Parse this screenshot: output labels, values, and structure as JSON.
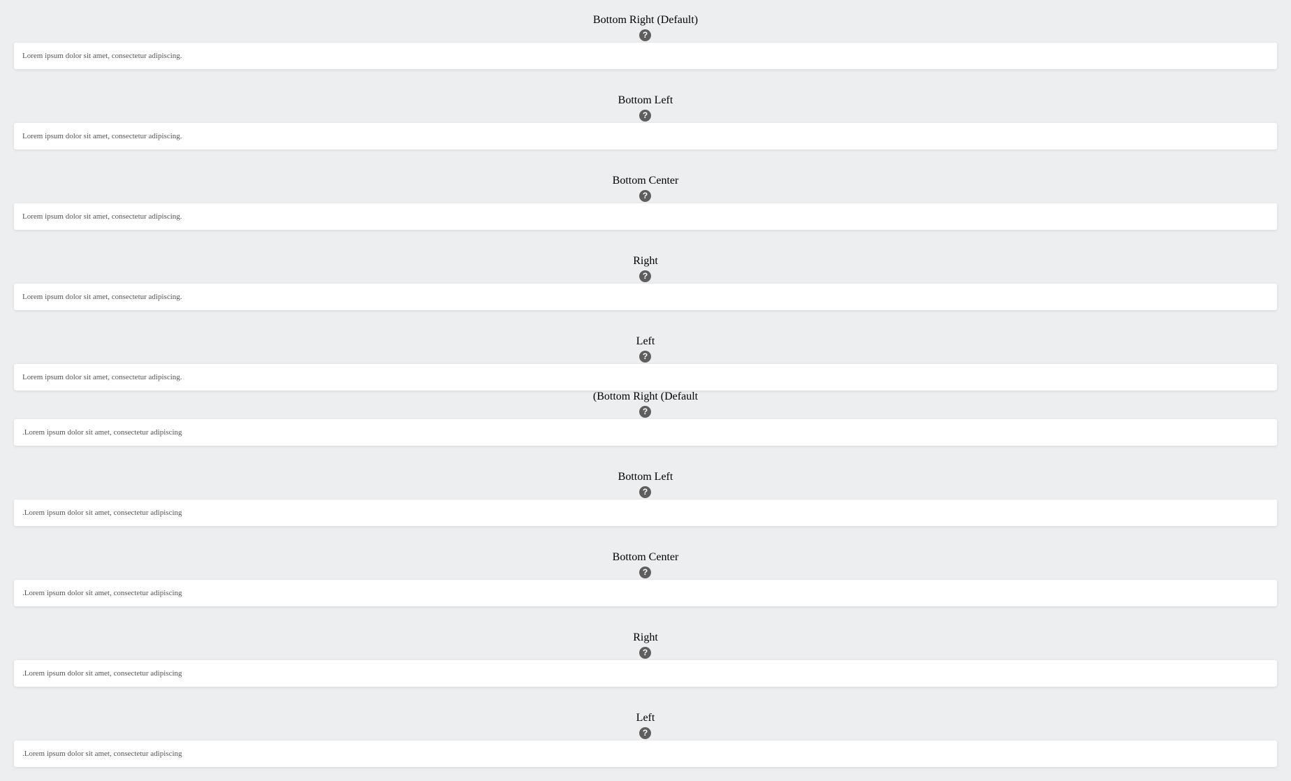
{
  "sections": [
    {
      "title": "Bottom Right (Default)",
      "help_icon": "?",
      "text": "Lorem ipsum dolor sit amet, consectetur adipiscing."
    },
    {
      "title": "Bottom Left",
      "help_icon": "?",
      "text": "Lorem ipsum dolor sit amet, consectetur adipiscing."
    },
    {
      "title": "Bottom Center",
      "help_icon": "?",
      "text": "Lorem ipsum dolor sit amet, consectetur adipiscing."
    },
    {
      "title": "Right",
      "help_icon": "?",
      "text": "Lorem ipsum dolor sit amet, consectetur adipiscing."
    },
    {
      "title": "Left",
      "help_icon": "?",
      "text": "Lorem ipsum dolor sit amet, consectetur adipiscing."
    },
    {
      "title": "(Bottom Right (Default",
      "help_icon": "?",
      "text": ".Lorem ipsum dolor sit amet, consectetur adipiscing"
    },
    {
      "title": "Bottom Left",
      "help_icon": "?",
      "text": ".Lorem ipsum dolor sit amet, consectetur adipiscing"
    },
    {
      "title": "Bottom Center",
      "help_icon": "?",
      "text": ".Lorem ipsum dolor sit amet, consectetur adipiscing"
    },
    {
      "title": "Right",
      "help_icon": "?",
      "text": ".Lorem ipsum dolor sit amet, consectetur adipiscing"
    },
    {
      "title": "Left",
      "help_icon": "?",
      "text": ".Lorem ipsum dolor sit amet, consectetur adipiscing"
    }
  ]
}
